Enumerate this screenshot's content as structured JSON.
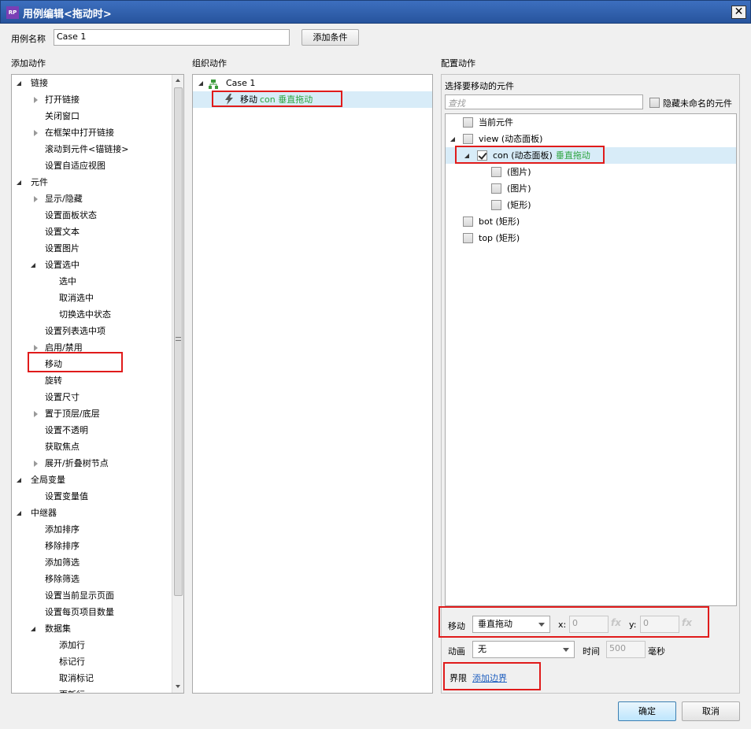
{
  "window": {
    "title": "用例编辑<拖动时>",
    "close_glyph": "✕",
    "app_badge": "RP"
  },
  "case_name": {
    "label": "用例名称",
    "value": "Case 1"
  },
  "add_condition_label": "添加条件",
  "columns": {
    "add_action": "添加动作",
    "organize_action": "组织动作",
    "configure_action": "配置动作"
  },
  "action_tree": [
    {
      "label": "链接",
      "level": 0,
      "toggle": "open"
    },
    {
      "label": "打开链接",
      "level": 1,
      "toggle": "closed"
    },
    {
      "label": "关闭窗口",
      "level": 1,
      "toggle": "none"
    },
    {
      "label": "在框架中打开链接",
      "level": 1,
      "toggle": "closed"
    },
    {
      "label": "滚动到元件<锚链接>",
      "level": 1,
      "toggle": "none"
    },
    {
      "label": "设置自适应视图",
      "level": 1,
      "toggle": "none"
    },
    {
      "label": "元件",
      "level": 0,
      "toggle": "open"
    },
    {
      "label": "显示/隐藏",
      "level": 1,
      "toggle": "closed"
    },
    {
      "label": "设置面板状态",
      "level": 1,
      "toggle": "none"
    },
    {
      "label": "设置文本",
      "level": 1,
      "toggle": "none"
    },
    {
      "label": "设置图片",
      "level": 1,
      "toggle": "none"
    },
    {
      "label": "设置选中",
      "level": 1,
      "toggle": "open"
    },
    {
      "label": "选中",
      "level": 2,
      "toggle": "none"
    },
    {
      "label": "取消选中",
      "level": 2,
      "toggle": "none"
    },
    {
      "label": "切换选中状态",
      "level": 2,
      "toggle": "none"
    },
    {
      "label": "设置列表选中项",
      "level": 1,
      "toggle": "none"
    },
    {
      "label": "启用/禁用",
      "level": 1,
      "toggle": "closed"
    },
    {
      "label": "移动",
      "level": 1,
      "toggle": "none"
    },
    {
      "label": "旋转",
      "level": 1,
      "toggle": "none"
    },
    {
      "label": "设置尺寸",
      "level": 1,
      "toggle": "none"
    },
    {
      "label": "置于顶层/底层",
      "level": 1,
      "toggle": "closed"
    },
    {
      "label": "设置不透明",
      "level": 1,
      "toggle": "none"
    },
    {
      "label": "获取焦点",
      "level": 1,
      "toggle": "none"
    },
    {
      "label": "展开/折叠树节点",
      "level": 1,
      "toggle": "closed"
    },
    {
      "label": "全局变量",
      "level": 0,
      "toggle": "open"
    },
    {
      "label": "设置变量值",
      "level": 1,
      "toggle": "none"
    },
    {
      "label": "中继器",
      "level": 0,
      "toggle": "open"
    },
    {
      "label": "添加排序",
      "level": 1,
      "toggle": "none"
    },
    {
      "label": "移除排序",
      "level": 1,
      "toggle": "none"
    },
    {
      "label": "添加筛选",
      "level": 1,
      "toggle": "none"
    },
    {
      "label": "移除筛选",
      "level": 1,
      "toggle": "none"
    },
    {
      "label": "设置当前显示页面",
      "level": 1,
      "toggle": "none"
    },
    {
      "label": "设置每页项目数量",
      "level": 1,
      "toggle": "none"
    },
    {
      "label": "数据集",
      "level": 1,
      "toggle": "open"
    },
    {
      "label": "添加行",
      "level": 2,
      "toggle": "none"
    },
    {
      "label": "标记行",
      "level": 2,
      "toggle": "none"
    },
    {
      "label": "取消标记",
      "level": 2,
      "toggle": "none"
    },
    {
      "label": "更新行",
      "level": 2,
      "toggle": "none"
    }
  ],
  "organize": {
    "case_label": "Case 1",
    "action_prefix": "移动",
    "action_detail": "con 垂直拖动"
  },
  "configure": {
    "select_widget_label": "选择要移动的元件",
    "search_placeholder": "查找",
    "hide_unnamed_label": "隐藏未命名的元件",
    "widgets": [
      {
        "name": "当前元件",
        "detail": "",
        "level": 0,
        "toggle": "none",
        "checked": false
      },
      {
        "name": "view (动态面板)",
        "detail": "",
        "level": 0,
        "toggle": "open",
        "checked": false
      },
      {
        "name": "con (动态面板)",
        "detail": "垂直拖动",
        "level": 1,
        "toggle": "open",
        "checked": true
      },
      {
        "name": "(图片)",
        "detail": "",
        "level": 2,
        "toggle": "none",
        "checked": false
      },
      {
        "name": "(图片)",
        "detail": "",
        "level": 2,
        "toggle": "none",
        "checked": false
      },
      {
        "name": "(矩形)",
        "detail": "",
        "level": 2,
        "toggle": "none",
        "checked": false
      },
      {
        "name": "bot (矩形)",
        "detail": "",
        "level": 0,
        "toggle": "none",
        "checked": false
      },
      {
        "name": "top (矩形)",
        "detail": "",
        "level": 0,
        "toggle": "none",
        "checked": false
      }
    ],
    "move_label": "移动",
    "move_value": "垂直拖动",
    "x_label": "x:",
    "x_value": "0",
    "y_label": "y:",
    "y_value": "0",
    "fx_label": "fx",
    "animation_label": "动画",
    "animation_value": "无",
    "time_label": "时间",
    "time_value": "500",
    "time_unit": "毫秒",
    "bounds_label": "界限",
    "add_bounds_label": "添加边界"
  },
  "footer": {
    "ok_label": "确定",
    "cancel_label": "取消"
  }
}
